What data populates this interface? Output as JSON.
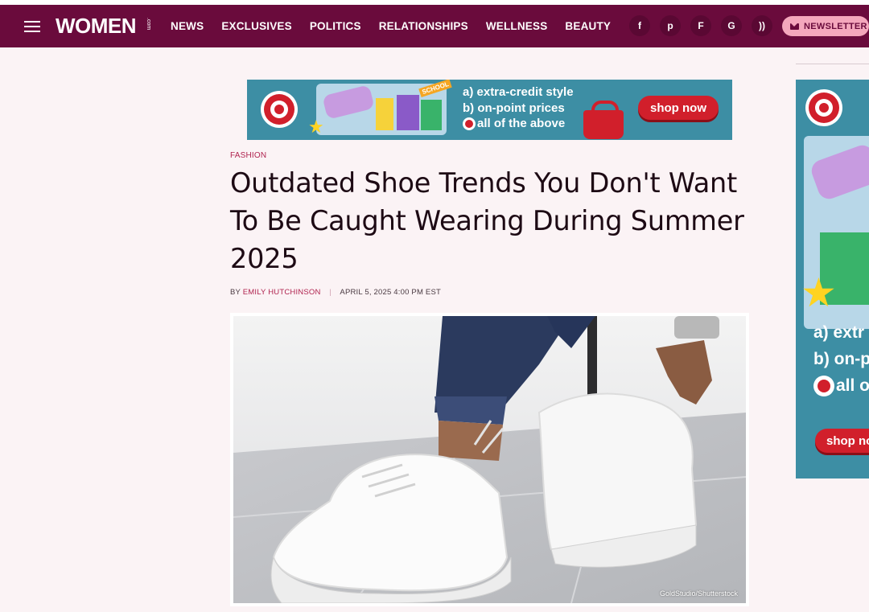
{
  "header": {
    "logo": "WOMEN",
    "logo_suffix": ".com",
    "nav": [
      "NEWS",
      "EXCLUSIVES",
      "POLITICS",
      "RELATIONSHIPS",
      "WELLNESS",
      "BEAUTY"
    ],
    "social": [
      {
        "icon": "facebook-icon",
        "glyph": "f"
      },
      {
        "icon": "pinterest-icon",
        "glyph": "p"
      },
      {
        "icon": "flipboard-icon",
        "glyph": "F"
      },
      {
        "icon": "google-news-icon",
        "glyph": "G"
      },
      {
        "icon": "rss-icon",
        "glyph": "))"
      }
    ],
    "newsletter_label": "NEWSLETTER"
  },
  "ad_top": {
    "line1": "a) extra-credit style",
    "line2": "b) on-point prices",
    "line3": "all of the above",
    "badge": "SCHOOL",
    "cta": "shop now"
  },
  "ad_right": {
    "line1": "a) extr",
    "line2": "b) on-p",
    "line3": "all o",
    "cta": "shop no"
  },
  "article": {
    "category": "FASHION",
    "title": "Outdated Shoe Trends You Don't Want To Be Caught Wearing During Summer 2025",
    "by": "BY",
    "author": "EMILY HUTCHINSON",
    "date": "APRIL 5, 2025 4:00 PM EST",
    "image_credit": "GoldStudio/Shutterstock"
  },
  "colors": {
    "header_bg": "#6a0b3c",
    "accent": "#b0234f",
    "newsletter_bg": "#f4a7bc",
    "ad_red": "#d11f2b",
    "page_bg": "#fbf3f5"
  }
}
